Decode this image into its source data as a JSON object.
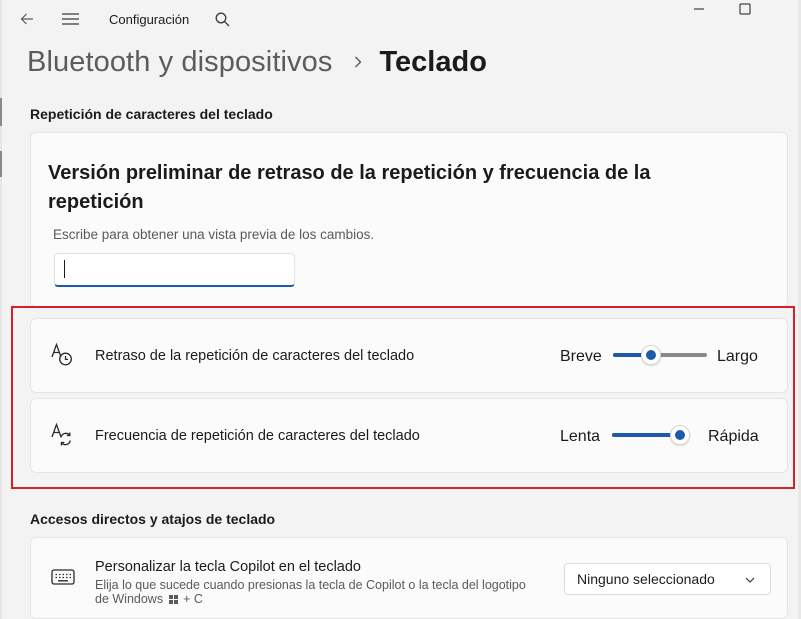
{
  "window": {
    "app_title": "Configuración"
  },
  "breadcrumb": {
    "parent": "Bluetooth y dispositivos",
    "current": "Teclado"
  },
  "sections": {
    "repeat_heading": "Repetición de caracteres del teclado",
    "shortcuts_heading": "Accesos directos y atajos de teclado"
  },
  "preview": {
    "title": "Versión preliminar de retraso de la repetición y frecuencia de la repetición",
    "hint": "Escribe para obtener una vista previa de los cambios.",
    "input_value": ""
  },
  "repeat_delay": {
    "label": "Retraso de la repetición de caracteres del teclado",
    "min_label": "Breve",
    "max_label": "Largo",
    "level": 0.38
  },
  "repeat_rate": {
    "label": "Frecuencia de repetición de caracteres del teclado",
    "min_label": "Lenta",
    "max_label": "Rápida",
    "level": 1.0
  },
  "copilot": {
    "title": "Personalizar la tecla Copilot en el teclado",
    "desc_part1": "Elija lo que sucede cuando presionas la tecla de Copilot o la tecla del logotipo de Windows",
    "desc_part2": "+ C",
    "dropdown_value": "Ninguno seleccionado"
  },
  "colors": {
    "accent": "#1d5aa8",
    "highlight": "#d42027",
    "background": "#f3f3f3",
    "card": "#fbfbfb"
  },
  "icons": {
    "back": "back-arrow-icon",
    "menu": "hamburger-menu-icon",
    "search": "search-icon",
    "minimize": "minimize-icon",
    "maximize": "maximize-icon",
    "breadcrumb_sep": "chevron-right-icon",
    "delay": "character-clock-icon",
    "rate": "character-repeat-icon",
    "keyboard": "keyboard-icon",
    "dropdown": "chevron-down-icon",
    "windows_logo": "windows-logo-icon"
  }
}
